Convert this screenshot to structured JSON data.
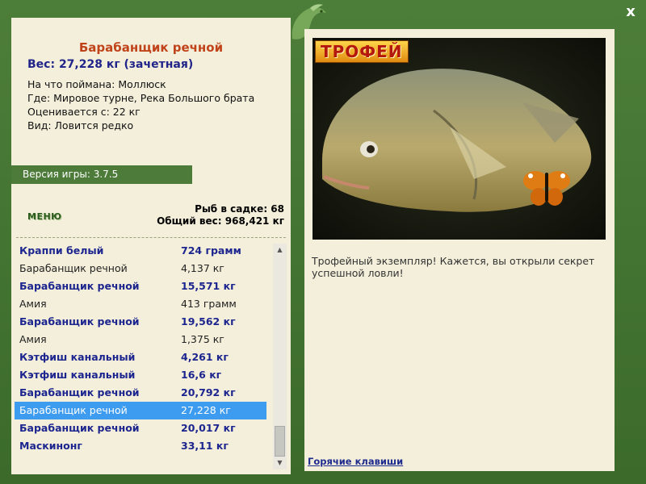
{
  "window": {
    "close_label": "x"
  },
  "fish": {
    "title": "Барабанщик речной",
    "weight": "Вес: 27,228 кг (зачетная)",
    "caught_on": "На что поймана: Моллюск",
    "where": "Где: Мировое турне, Река Большого брата",
    "value": "Оценивается с: 22 кг",
    "kind": "Вид: Ловится редко"
  },
  "version": "Версия игры: 3.7.5",
  "menu_label": "МЕНЮ",
  "stats": {
    "fish_in_cage": "Рыб в садке: 68",
    "total_weight": "Общий вес: 968,421 кг"
  },
  "catch_list": [
    {
      "name": "Краппи белый",
      "weight": "724 грамм",
      "style": "bold"
    },
    {
      "name": "Барабанщик речной",
      "weight": "4,137 кг",
      "style": "plain"
    },
    {
      "name": "Барабанщик речной",
      "weight": "15,571 кг",
      "style": "bold"
    },
    {
      "name": "Амия",
      "weight": "413 грамм",
      "style": "plain"
    },
    {
      "name": "Барабанщик речной",
      "weight": "19,562 кг",
      "style": "bold"
    },
    {
      "name": "Амия",
      "weight": "1,375 кг",
      "style": "plain"
    },
    {
      "name": "Кэтфиш канальный",
      "weight": "4,261 кг",
      "style": "bold"
    },
    {
      "name": "Кэтфиш канальный",
      "weight": "16,6 кг",
      "style": "bold"
    },
    {
      "name": "Барабанщик речной",
      "weight": "20,792 кг",
      "style": "bold"
    },
    {
      "name": "Барабанщик речной",
      "weight": "27,228 кг",
      "style": "selected"
    },
    {
      "name": "Барабанщик речной",
      "weight": "20,017 кг",
      "style": "bold"
    },
    {
      "name": "Маскинонг",
      "weight": "33,11 кг",
      "style": "bold"
    }
  ],
  "trophy_badge": "ТРОФЕЙ",
  "description": "Трофейный экземпляр! Кажется, вы открыли секрет успешной ловли!",
  "hotkeys_label": "Горячие клавиши",
  "colors": {
    "frame": "#4d7e39",
    "panel": "#f3efda",
    "selected": "#3e9cf0",
    "title": "#c0431a",
    "bold_text": "#1d258f"
  }
}
